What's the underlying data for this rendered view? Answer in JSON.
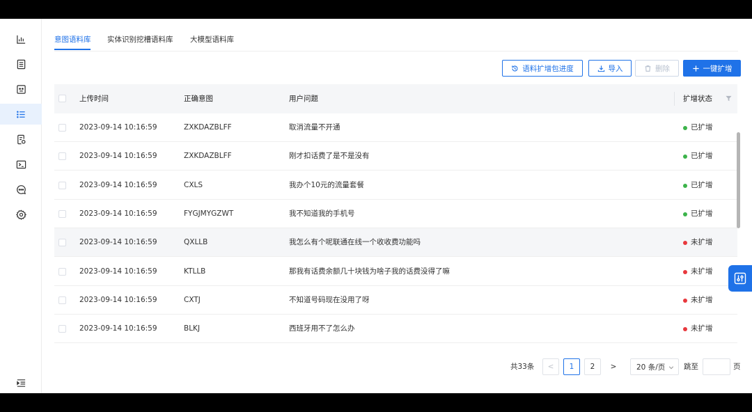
{
  "sidebar": {
    "items": [
      {
        "icon": "bar-chart-icon"
      },
      {
        "icon": "list-document-icon"
      },
      {
        "icon": "bot-face-icon"
      },
      {
        "icon": "list-icon",
        "active": true
      },
      {
        "icon": "file-settings-icon"
      },
      {
        "icon": "terminal-icon"
      },
      {
        "icon": "chat-bubble-icon"
      },
      {
        "icon": "gear-icon"
      }
    ],
    "footer_icon": "collapse-menu-icon"
  },
  "tabs": [
    {
      "label": "意图语料库",
      "active": true
    },
    {
      "label": "实体识别挖槽语料库"
    },
    {
      "label": "大模型语料库"
    }
  ],
  "toolbar": {
    "progress_label": "语料扩增包进度",
    "import_label": "导入",
    "delete_label": "删除",
    "expand_label": "一键扩增"
  },
  "table": {
    "columns": {
      "upload_time": "上传时间",
      "intent": "正确意图",
      "question": "用户问题",
      "status": "扩增状态"
    },
    "rows": [
      {
        "time": "2023-09-14 10:16:59",
        "intent": "ZXKDAZBLFF",
        "question": "取消流量不开通",
        "status": "已扩增",
        "expanded": true
      },
      {
        "time": "2023-09-14 10:16:59",
        "intent": "ZXKDAZBLFF",
        "question": "刚才扣话费了是不是没有",
        "status": "已扩增",
        "expanded": true
      },
      {
        "time": "2023-09-14 10:16:59",
        "intent": "CXLS",
        "question": "我办个10元的流量套餐",
        "status": "已扩增",
        "expanded": true
      },
      {
        "time": "2023-09-14 10:16:59",
        "intent": "FYGJMYGZWT",
        "question": "我不知道我的手机号",
        "status": "已扩增",
        "expanded": true
      },
      {
        "time": "2023-09-14 10:16:59",
        "intent": "QXLLB",
        "question": "我怎么有个呢联通在线一个收收费功能吗",
        "status": "未扩增",
        "expanded": false
      },
      {
        "time": "2023-09-14 10:16:59",
        "intent": "KTLLB",
        "question": "那我有话费余额几十块钱为啥子我的话费没得了嘛",
        "status": "未扩增",
        "expanded": false
      },
      {
        "time": "2023-09-14 10:16:59",
        "intent": "CXTJ",
        "question": "不知道号码现在没用了呀",
        "status": "未扩增",
        "expanded": false
      },
      {
        "time": "2023-09-14 10:16:59",
        "intent": "BLKJ",
        "question": "西班牙用不了怎么办",
        "status": "未扩增",
        "expanded": false
      }
    ]
  },
  "colors": {
    "accent": "#1f72e8",
    "expanded": "#3cb34a",
    "not_expanded": "#e8383d"
  },
  "pagination": {
    "total": "共33条",
    "prev": "<",
    "pages": [
      "1",
      "2"
    ],
    "current": "1",
    "next": ">",
    "page_size": "20 条/页",
    "jump_prefix": "跳至",
    "jump_suffix": "页"
  }
}
